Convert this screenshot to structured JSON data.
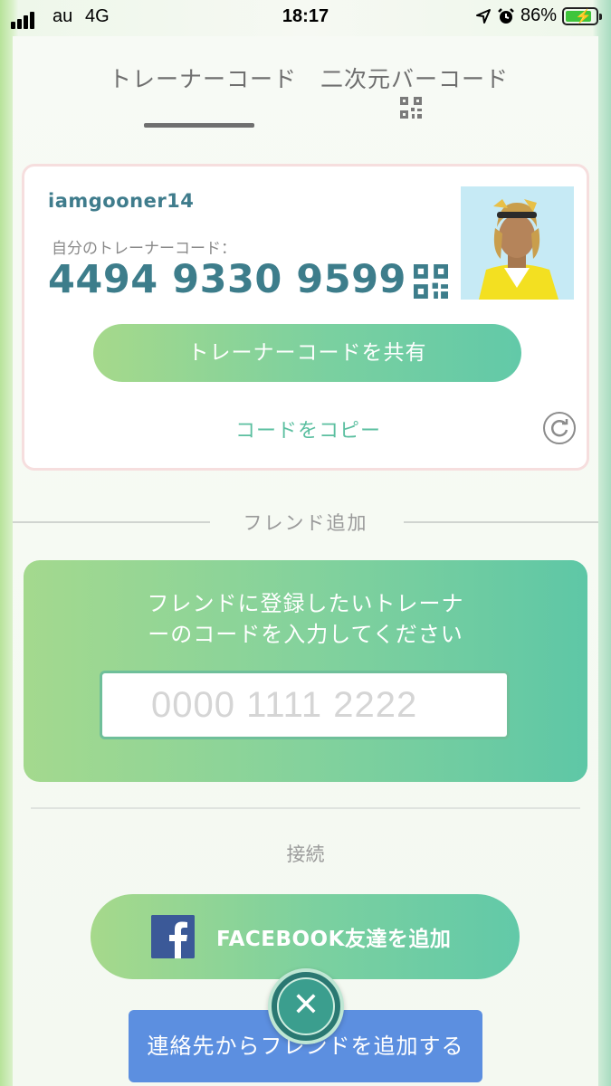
{
  "status_bar": {
    "carrier": "au",
    "network": "4G",
    "time": "18:17",
    "battery": "86%",
    "battery_level": 0.86
  },
  "tabs": [
    {
      "label": "トレーナーコード",
      "active": true
    },
    {
      "label": "二次元バーコード",
      "active": false,
      "icon": "qr-code-icon"
    }
  ],
  "trainer_card": {
    "username": "iamgooner14",
    "code_label": "自分のトレーナーコード：",
    "code_value": "4494 9330 9599",
    "share_button": "トレーナーコードを共有",
    "copy_link": "コードをコピー"
  },
  "add_friend": {
    "section_title": "フレンド追加",
    "prompt_line1": "フレンドに登録したいトレーナ",
    "prompt_line2": "ーのコードを入力してください",
    "input_placeholder": "0000 1111 2222",
    "input_value": ""
  },
  "connect": {
    "section_title": "接続",
    "facebook_button": "FACEBOOK友達を追加",
    "contacts_button": "連絡先からフレンドを追加する"
  },
  "colors": {
    "accent_teal": "#3d7d8b",
    "button_green": "#7ad0a0",
    "contacts_blue": "#5c8fe0",
    "facebook_blue": "#3b5998"
  }
}
